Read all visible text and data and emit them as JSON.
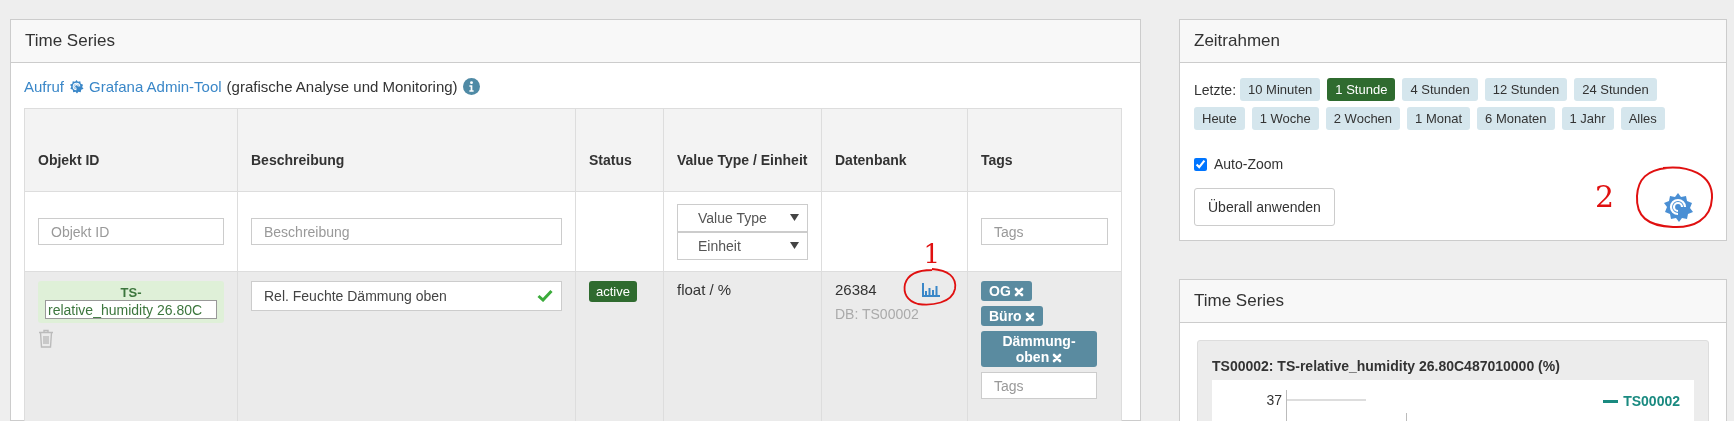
{
  "main_panel": {
    "title": "Time Series",
    "intro": {
      "link_call": "Aufruf",
      "link_tool": "Grafana Admin-Tool",
      "text": "(grafische Analyse und Monitoring)"
    },
    "table": {
      "columns": [
        "Objekt ID",
        "Beschreibung",
        "Status",
        "Value Type / Einheit",
        "Datenbank",
        "Tags"
      ],
      "filters": {
        "object_id": {
          "placeholder": "Objekt ID"
        },
        "description": {
          "placeholder": "Beschreibung"
        },
        "value_type": {
          "value": "Value Type"
        },
        "unit": {
          "value": "Einheit"
        },
        "tags": {
          "placeholder": "Tags"
        }
      },
      "rows": [
        {
          "id_prefix": "TS-",
          "id_value": "relative_humidity 26.80C",
          "description": "Rel. Feuchte Dämmung oben",
          "description_valid": true,
          "status": "active",
          "type_unit": "float / %",
          "database": "26384",
          "db_name": "DB: TS00002",
          "tags": [
            "OG",
            "Büro",
            "Dämmung-oben"
          ],
          "tag_input": {
            "placeholder": "Tags"
          }
        }
      ]
    }
  },
  "timeframe_panel": {
    "title": "Zeitrahmen",
    "label": "Letzte:",
    "ranges": [
      {
        "label": "10 Minuten",
        "selected": false
      },
      {
        "label": "1 Stunde",
        "selected": true
      },
      {
        "label": "4 Stunden",
        "selected": false
      },
      {
        "label": "12 Stunden",
        "selected": false
      },
      {
        "label": "24 Stunden",
        "selected": false
      },
      {
        "label": "Heute",
        "selected": false
      },
      {
        "label": "1 Woche",
        "selected": false
      },
      {
        "label": "2 Wochen",
        "selected": false
      },
      {
        "label": "1 Monat",
        "selected": false
      },
      {
        "label": "6 Monaten",
        "selected": false
      },
      {
        "label": "1 Jahr",
        "selected": false
      },
      {
        "label": "Alles",
        "selected": false
      }
    ],
    "auto_zoom": {
      "label": "Auto-Zoom",
      "checked": true
    },
    "apply_button": "Überall anwenden"
  },
  "series_panel": {
    "title": "Time Series",
    "chart_title": "TS00002: TS-relative_humidity 26.80C487010000 (%)",
    "y_tick": "37",
    "legend": "TS00002"
  },
  "annotations": [
    {
      "text": "1"
    },
    {
      "text": "2"
    }
  ]
}
